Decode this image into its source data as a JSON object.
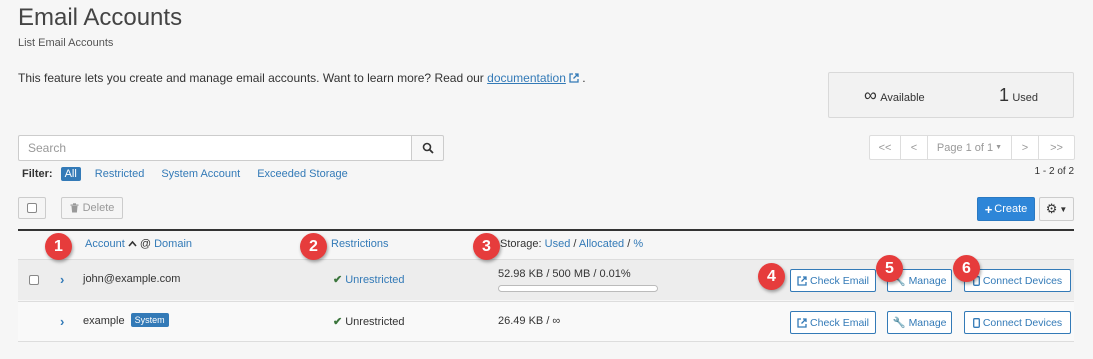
{
  "header": {
    "title": "Email Accounts",
    "subtitle": "List Email Accounts",
    "description": "This feature lets you create and manage email accounts. Want to learn more? Read our",
    "doc_link": "documentation",
    "desc_end": "."
  },
  "stats": {
    "available_value": "∞",
    "available_label": "Available",
    "used_value": "1",
    "used_label": "Used"
  },
  "search": {
    "placeholder": "Search",
    "value": ""
  },
  "filter": {
    "label": "Filter:",
    "options": [
      "All",
      "Restricted",
      "System Account",
      "Exceeded Storage"
    ],
    "active": "All"
  },
  "pagination": {
    "first": "<<",
    "prev": "<",
    "page": "Page 1 of 1",
    "next": ">",
    "last": ">>",
    "range": "1 - 2 of 2"
  },
  "toolbar": {
    "delete_label": "Delete",
    "create_label": "Create"
  },
  "table": {
    "columns": {
      "account": "Account",
      "at": "@",
      "domain": "Domain",
      "restrictions": "Restrictions",
      "storage": "Storage:",
      "used": "Used",
      "allocated": "Allocated",
      "percent": "%",
      "sep": "/"
    },
    "rows": [
      {
        "account": "john@example.com",
        "badge": "",
        "restriction": "Unrestricted",
        "storage": "52.98 KB / 500 MB / 0.01%",
        "usage_fraction": 0.0001,
        "check_email": "Check Email",
        "manage": "Manage",
        "connect": "Connect Devices"
      },
      {
        "account": "example",
        "badge": "System",
        "restriction": "Unrestricted",
        "storage": "26.49 KB / ∞",
        "check_email": "Check Email",
        "manage": "Manage",
        "connect": "Connect Devices"
      }
    ]
  },
  "callouts": [
    "1",
    "2",
    "3",
    "4",
    "5",
    "6"
  ],
  "colors": {
    "accent": "#337ab7",
    "primary_button": "#2e86d8",
    "callout": "#e63c3c",
    "success": "#3c763d"
  }
}
